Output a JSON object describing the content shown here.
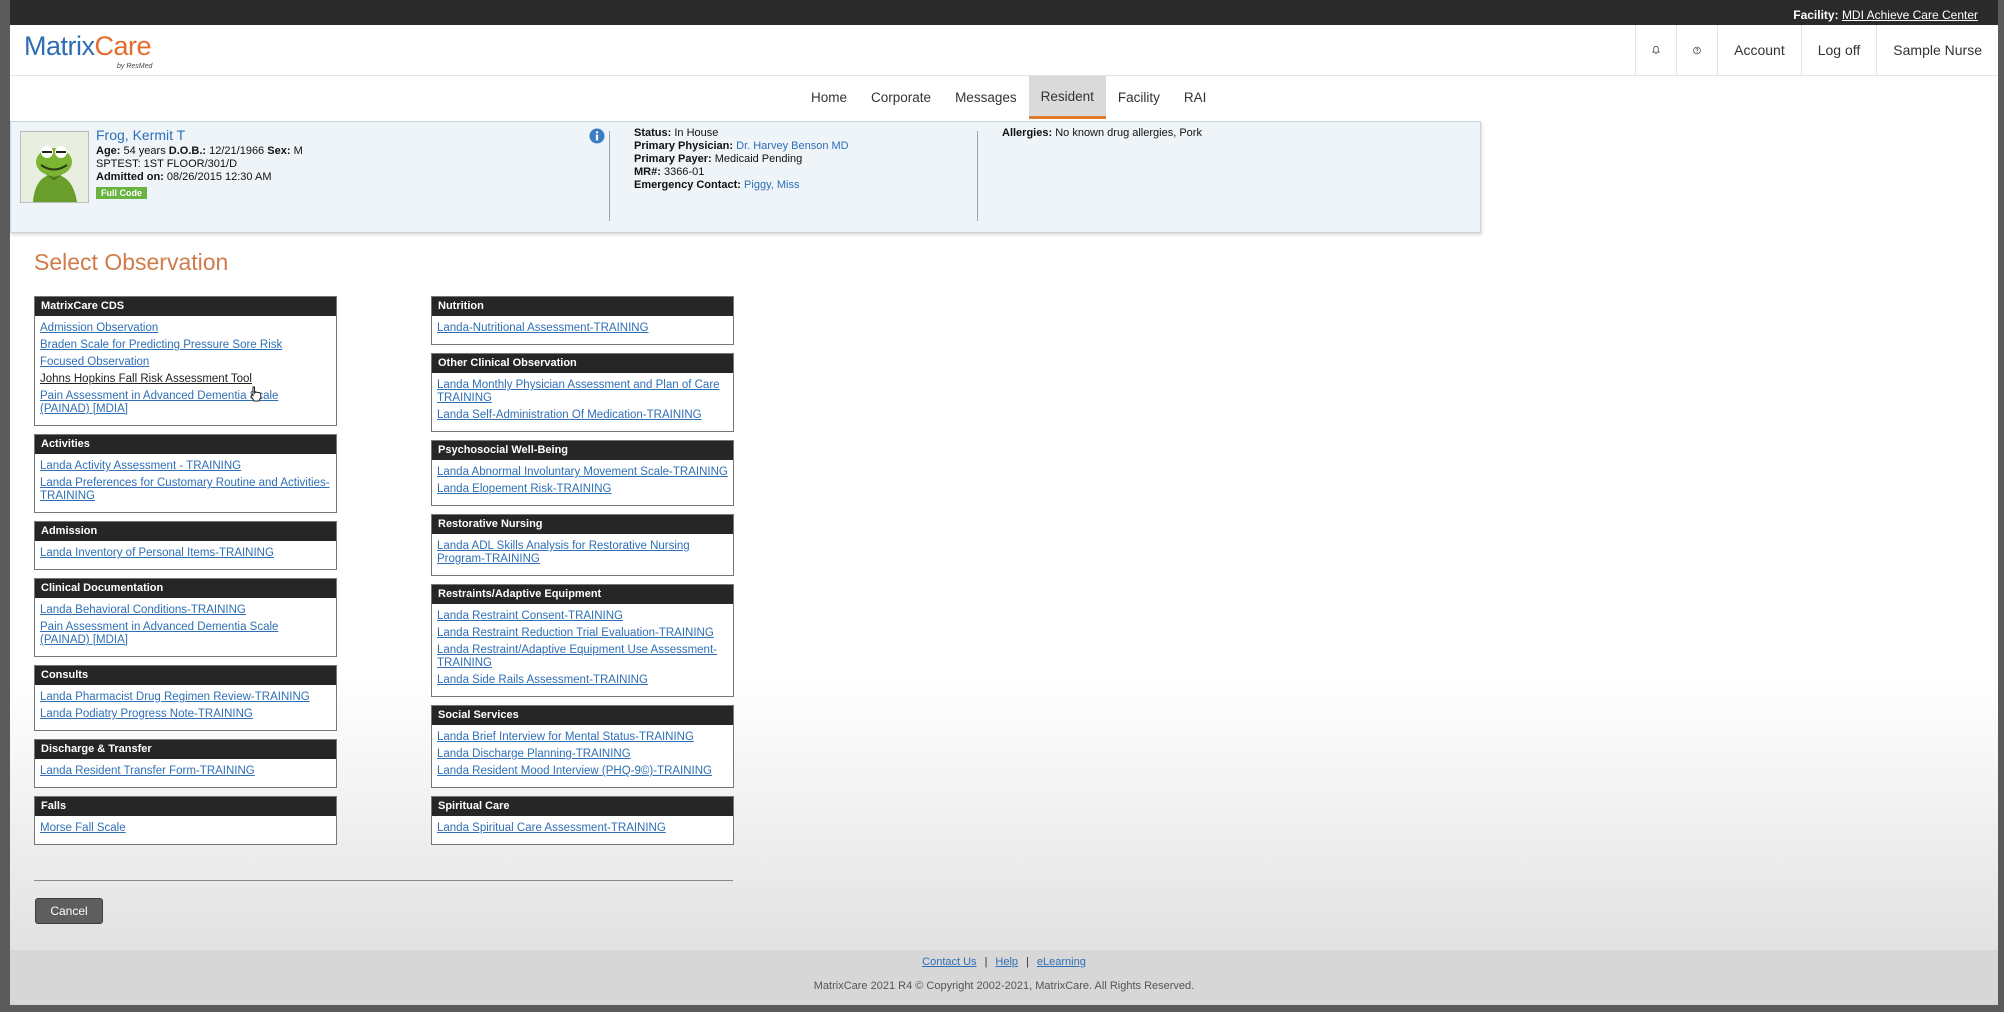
{
  "topbar": {
    "facility_label": "Facility:",
    "facility_name": "MDI Achieve Care Center"
  },
  "logo": {
    "brand_matrix": "Matrix",
    "brand_care": "Care",
    "by": "by ResMed"
  },
  "header_nav": {
    "account": "Account",
    "logoff": "Log off",
    "user": "Sample Nurse",
    "icons": [
      "bell-icon",
      "help-icon"
    ]
  },
  "main_nav": {
    "tabs": [
      "Home",
      "Corporate",
      "Messages",
      "Resident",
      "Facility",
      "RAI"
    ],
    "active": "Resident"
  },
  "resident": {
    "name": "Frog, Kermit T",
    "age_label": "Age:",
    "age": "54 years",
    "dob_label": "D.O.B.:",
    "dob": "12/21/1966",
    "sex_label": "Sex:",
    "sex": "M",
    "location": "SPTEST: 1ST FLOOR/301/D",
    "admitted_label": "Admitted on:",
    "admitted": "08/26/2015 12:30 AM",
    "code_status": "Full Code",
    "status_label": "Status:",
    "status": "In House",
    "physician_label": "Primary Physician:",
    "physician": "Dr. Harvey Benson MD",
    "payer_label": "Primary Payer:",
    "payer": "Medicaid Pending",
    "mr_label": "MR#:",
    "mr": "3366-01",
    "emergency_label": "Emergency Contact:",
    "emergency": "Piggy, Miss",
    "allergies_label": "Allergies:",
    "allergies": "No known drug allergies, Pork"
  },
  "page": {
    "title": "Select Observation",
    "cancel": "Cancel"
  },
  "left_sections": [
    {
      "header": "MatrixCare CDS",
      "items": [
        "Admission Observation",
        "Braden Scale for Predicting Pressure Sore Risk",
        "Focused Observation",
        "Johns Hopkins Fall Risk Assessment Tool",
        "Pain Assessment in Advanced Dementia Scale (PAINAD) [MDIA]"
      ]
    },
    {
      "header": "Activities",
      "items": [
        "Landa Activity Assessment - TRAINING",
        "Landa Preferences for Customary Routine and Activities-TRAINING"
      ]
    },
    {
      "header": "Admission",
      "items": [
        "Landa Inventory of Personal Items-TRAINING"
      ]
    },
    {
      "header": "Clinical Documentation",
      "items": [
        "Landa Behavioral Conditions-TRAINING",
        "Pain Assessment in Advanced Dementia Scale (PAINAD) [MDIA]"
      ]
    },
    {
      "header": "Consults",
      "items": [
        "Landa Pharmacist Drug Regimen Review-TRAINING",
        "Landa Podiatry Progress Note-TRAINING"
      ]
    },
    {
      "header": "Discharge & Transfer",
      "items": [
        "Landa Resident Transfer Form-TRAINING"
      ]
    },
    {
      "header": "Falls",
      "items": [
        "Morse Fall Scale"
      ]
    }
  ],
  "right_sections": [
    {
      "header": "Nutrition",
      "items": [
        "Landa-Nutritional Assessment-TRAINING"
      ]
    },
    {
      "header": "Other Clinical Observation",
      "items": [
        "Landa Monthly Physician Assessment and Plan of Care TRAINING",
        "Landa Self-Administration Of Medication-TRAINING"
      ]
    },
    {
      "header": "Psychosocial Well-Being",
      "items": [
        "Landa Abnormal Involuntary Movement Scale-TRAINING",
        "Landa Elopement Risk-TRAINING"
      ]
    },
    {
      "header": "Restorative Nursing",
      "items": [
        "Landa ADL Skills Analysis for Restorative Nursing Program-TRAINING"
      ]
    },
    {
      "header": "Restraints/Adaptive Equipment",
      "items": [
        "Landa Restraint Consent-TRAINING",
        "Landa Restraint Reduction Trial Evaluation-TRAINING",
        "Landa Restraint/Adaptive Equipment Use Assessment-TRAINING",
        "Landa Side Rails Assessment-TRAINING"
      ]
    },
    {
      "header": "Social Services",
      "items": [
        "Landa Brief Interview for Mental Status-TRAINING",
        "Landa Discharge Planning-TRAINING",
        "Landa Resident Mood Interview (PHQ-9©)-TRAINING"
      ]
    },
    {
      "header": "Spiritual Care",
      "items": [
        "Landa Spiritual Care Assessment-TRAINING"
      ]
    }
  ],
  "footer": {
    "contact": "Contact Us",
    "help": "Help",
    "elearning": "eLearning",
    "separator": "|",
    "copyright": "MatrixCare 2021 R4 © Copyright 2002-2021, MatrixCare. All Rights Reserved."
  },
  "colors": {
    "link": "#2f6fb6",
    "accent_orange": "#e07b2c",
    "title": "#d07c4a",
    "header_dark": "#262626",
    "full_code_badge": "#69b340"
  }
}
